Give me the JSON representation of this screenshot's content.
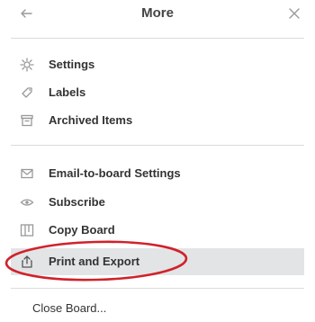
{
  "header": {
    "title": "More"
  },
  "icons": {
    "back": "arrow-left-icon",
    "close": "close-icon"
  },
  "sections": {
    "general": [
      {
        "label": "Settings",
        "icon": "gear-icon"
      },
      {
        "label": "Labels",
        "icon": "tag-icon"
      },
      {
        "label": "Archived Items",
        "icon": "archive-icon"
      }
    ],
    "board": [
      {
        "label": "Email-to-board Settings",
        "icon": "email-icon"
      },
      {
        "label": "Subscribe",
        "icon": "eye-icon"
      },
      {
        "label": "Copy Board",
        "icon": "copy-board-icon"
      },
      {
        "label": "Print and Export",
        "icon": "share-export-icon",
        "highlighted": true
      }
    ],
    "footer": [
      {
        "label": "Close Board...",
        "icon": ""
      }
    ]
  },
  "colors": {
    "highlight_bg": "#e2e4e6",
    "annotation_circle": "#d0222a",
    "icon_gray": "#999999",
    "text": "#333333"
  }
}
